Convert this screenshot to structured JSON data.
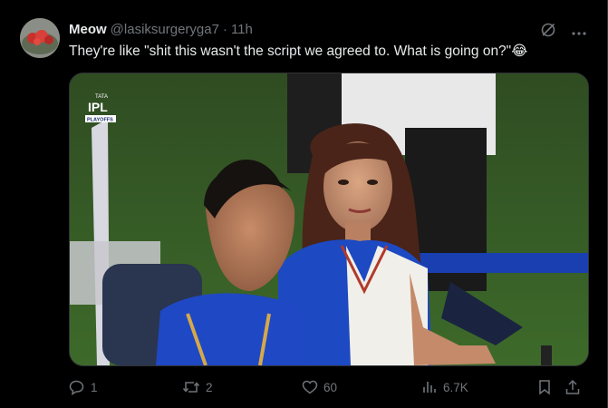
{
  "post": {
    "author_name": "Meow",
    "author_handle": "@lasiksurgeryga7",
    "separator": "·",
    "time": "11h",
    "text": "They're like \"shit this wasn't the script we agreed to. What is going on?\"😂",
    "media_badge": {
      "line1": "TATA",
      "line2": "IPL",
      "line3": "PLAYOFFS"
    }
  },
  "header_icons": [
    "grok-icon",
    "more-icon"
  ],
  "actions": {
    "reply_count": "1",
    "repost_count": "2",
    "like_count": "60",
    "views_count": "6.7K"
  },
  "colors": {
    "background": "#000000",
    "text": "#e7e9ea",
    "muted": "#71767b",
    "border": "#2f3336"
  }
}
